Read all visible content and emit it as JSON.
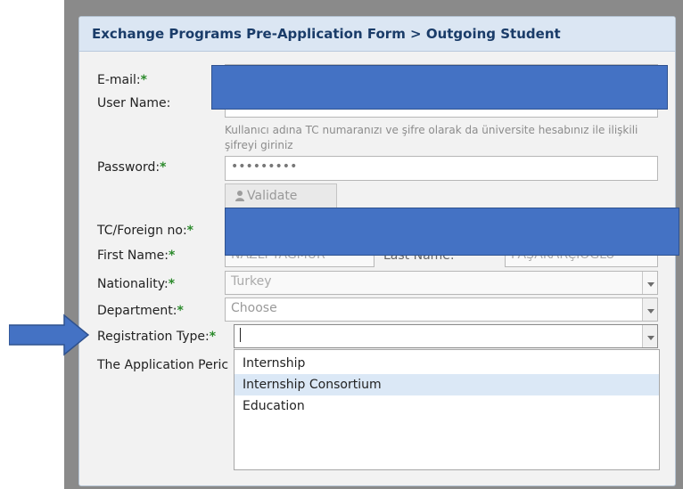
{
  "form": {
    "title": "Exchange Programs Pre-Application Form > Outgoing Student",
    "labels": {
      "email": "E-mail:",
      "user_name": "User Name:",
      "password": "Password:",
      "tc_foreign_no": "TC/Foreign no:",
      "first_name": "First Name:",
      "last_name": "Last Name:",
      "nationality": "Nationality:",
      "department": "Department:",
      "registration_type": "Registration Type:",
      "application_period": "The Application Peric"
    },
    "required_mark": "*",
    "hint": "Kullanıcı adına TC numaranızı ve şifre olarak da üniversite hesabınız ile ilişkili şifreyi giriniz",
    "password_value": "•••••••••",
    "validate_label": "Validate",
    "first_name_value": "NAZLI YAĞMUR",
    "last_name_value": "PAŞAKARÇIOĞLU",
    "nationality_value": "Turkey",
    "department_value": "Choose",
    "registration_type_value": ""
  },
  "dropdown": {
    "options": [
      "Internship",
      "Internship Consortium",
      "Education"
    ],
    "highlighted": "Internship Consortium"
  },
  "colors": {
    "header_bg": "#dbe6f3",
    "title": "#1a3c69",
    "required": "#2b8a2b",
    "redaction": "#4472c4",
    "highlight": "#dbe8f6"
  }
}
